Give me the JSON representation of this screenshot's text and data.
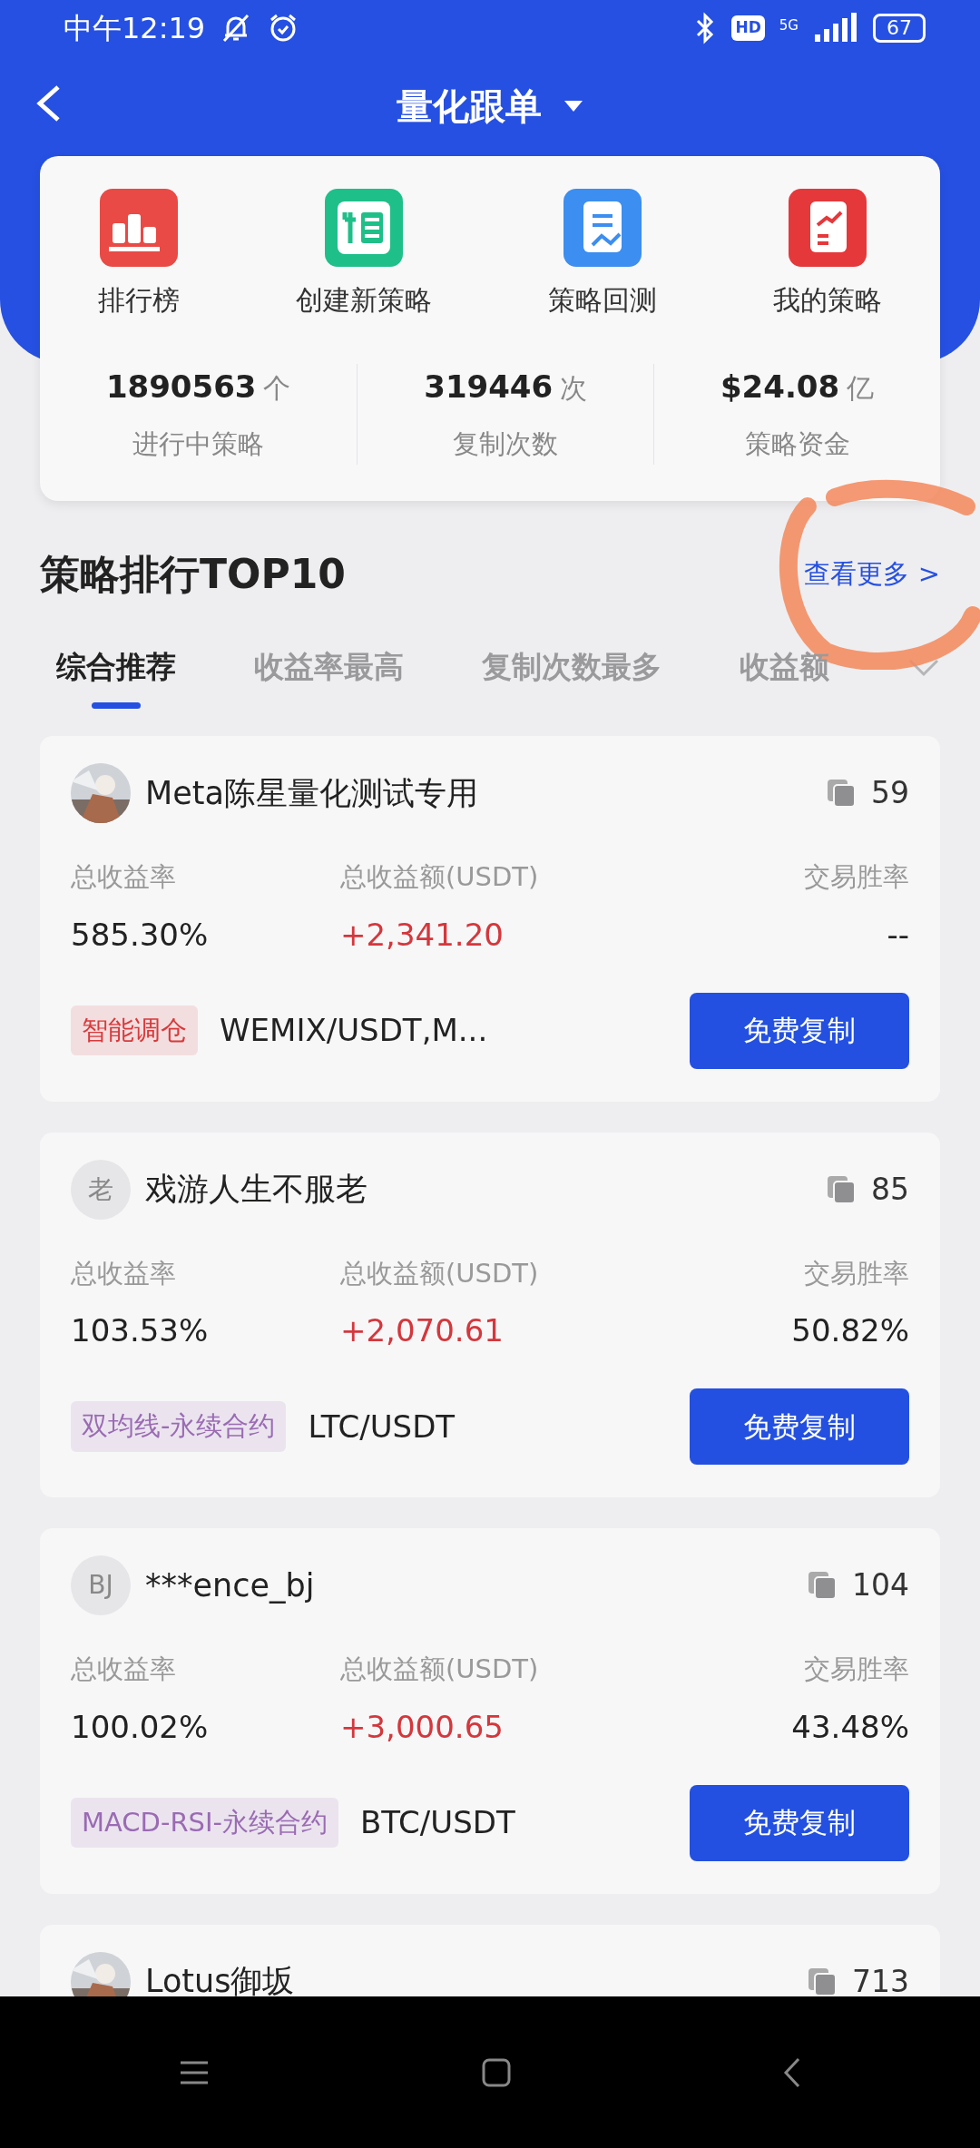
{
  "status_bar": {
    "time": "中午12:19",
    "network_label": "HD",
    "network_type": "5G",
    "battery": "67"
  },
  "header": {
    "title": "量化跟单"
  },
  "shortcuts": [
    {
      "label": "排行榜",
      "kind": "ranking"
    },
    {
      "label": "创建新策略",
      "kind": "create"
    },
    {
      "label": "策略回测",
      "kind": "backtest"
    },
    {
      "label": "我的策略",
      "kind": "mine"
    }
  ],
  "stats": [
    {
      "value": "1890563",
      "unit": "个",
      "label": "进行中策略"
    },
    {
      "value": "319446",
      "unit": "次",
      "label": "复制次数"
    },
    {
      "value": "$24.08",
      "unit": "亿",
      "label": "策略资金"
    }
  ],
  "section": {
    "title": "策略排行TOP10",
    "more_link": "查看更多 >"
  },
  "tabs": [
    {
      "label": "综合推荐",
      "selected": true
    },
    {
      "label": "收益率最高",
      "selected": false
    },
    {
      "label": "复制次数最多",
      "selected": false
    },
    {
      "label": "收益额",
      "selected": false
    }
  ],
  "strategies": [
    {
      "avatar": {
        "kind": "picture"
      },
      "name": "Meta陈星量化测试专用",
      "copies": "59",
      "metrics": [
        {
          "label": "总收益率",
          "value": "585.30%"
        },
        {
          "label": "总收益额(USDT)",
          "value": "+2,341.20",
          "positive": true
        },
        {
          "label": "交易胜率",
          "value": "--"
        }
      ],
      "tag": {
        "text": "智能调仓",
        "color": "#d83a3c"
      },
      "pairs": "WEMIX/USDT,M...",
      "button": "免费复制"
    },
    {
      "avatar": {
        "kind": "letter",
        "text": "老"
      },
      "name": "戏游人生不服老",
      "copies": "85",
      "metrics": [
        {
          "label": "总收益率",
          "value": "103.53%"
        },
        {
          "label": "总收益额(USDT)",
          "value": "+2,070.61",
          "positive": true
        },
        {
          "label": "交易胜率",
          "value": "50.82%"
        }
      ],
      "tag": {
        "text": "双均线-永续合约",
        "color": "#9a6bb3"
      },
      "pairs": "LTC/USDT",
      "button": "免费复制"
    },
    {
      "avatar": {
        "kind": "letter",
        "text": "BJ"
      },
      "name": "***ence_bj",
      "copies": "104",
      "metrics": [
        {
          "label": "总收益率",
          "value": "100.02%"
        },
        {
          "label": "总收益额(USDT)",
          "value": "+3,000.65",
          "positive": true
        },
        {
          "label": "交易胜率",
          "value": "43.48%"
        }
      ],
      "tag": {
        "text": "MACD-RSI-永续合约",
        "color": "#9a6bb3"
      },
      "pairs": "BTC/USDT",
      "button": "免费复制"
    },
    {
      "avatar": {
        "kind": "picture"
      },
      "name": "Lotus御坂",
      "copies": "713"
    }
  ]
}
